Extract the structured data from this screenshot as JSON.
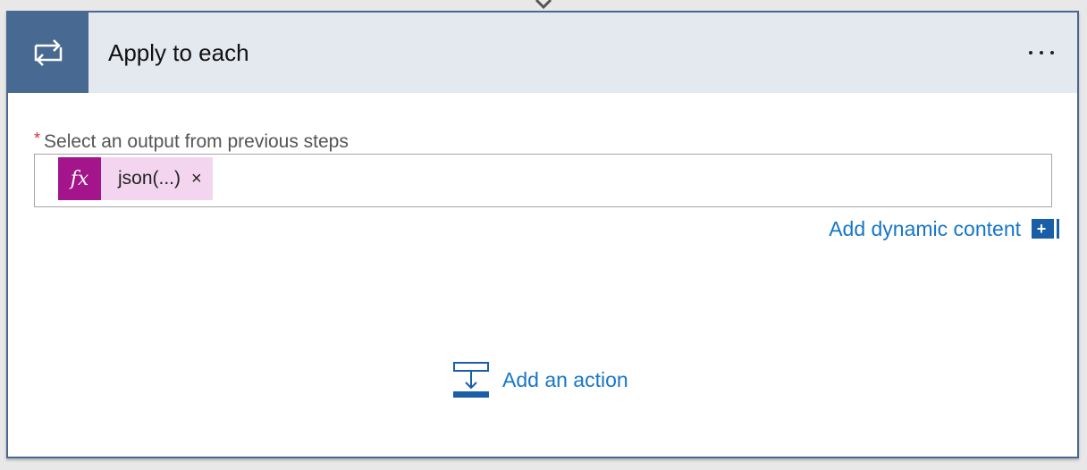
{
  "header": {
    "title": "Apply to each",
    "icon": "loop-icon",
    "more_icon": "ellipsis-icon"
  },
  "field": {
    "label": "Select an output from previous steps",
    "required_mark": "*",
    "token": {
      "icon_text": "fx",
      "label": "json(...)",
      "remove_glyph": "×"
    }
  },
  "dynamic_content": {
    "label": "Add dynamic content",
    "icon_glyph": "+"
  },
  "add_action": {
    "label": "Add an action",
    "icon": "add-action-icon"
  },
  "colors": {
    "accent": "#486991",
    "link": "#1776c8",
    "token": "#a4148a",
    "token_bg": "#f4d5ef",
    "required": "#d13438"
  }
}
